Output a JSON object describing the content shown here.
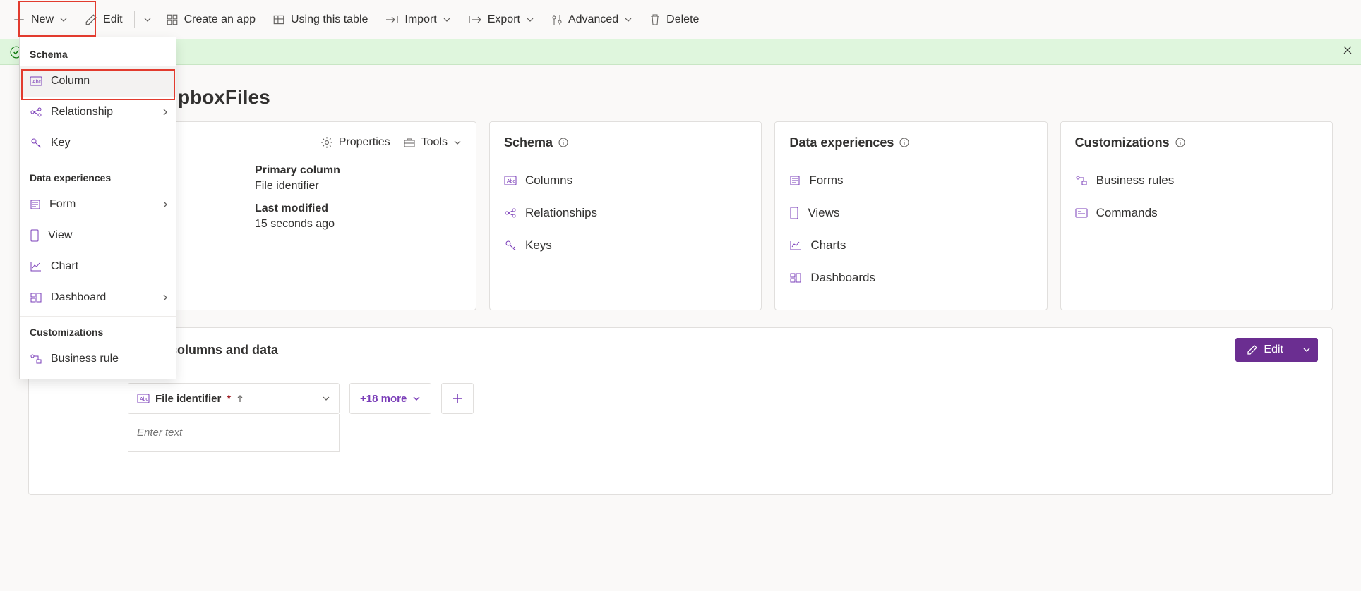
{
  "toolbar": {
    "new": "New",
    "edit": "Edit",
    "create_app": "Create an app",
    "using_table": "Using this table",
    "import": "Import",
    "export": "Export",
    "advanced": "Advanced",
    "delete": "Delete"
  },
  "dropdown": {
    "sections": {
      "schema": "Schema",
      "data_exp": "Data experiences",
      "custom": "Customizations"
    },
    "items": {
      "column": "Column",
      "relationship": "Relationship",
      "key": "Key",
      "form": "Form",
      "view": "View",
      "chart": "Chart",
      "dashboard": "Dashboard",
      "business_rule": "Business rule"
    }
  },
  "page": {
    "title_suffix": "pboxFiles"
  },
  "card1": {
    "properties": "Properties",
    "tools": "Tools",
    "primary_col_label": "Primary column",
    "primary_col_value": "File identifier",
    "last_mod_label": "Last modified",
    "last_mod_value": "15 seconds ago"
  },
  "card2": {
    "title": "Schema",
    "columns": "Columns",
    "relationships": "Relationships",
    "keys": "Keys"
  },
  "card3": {
    "title": "Data experiences",
    "forms": "Forms",
    "views": "Views",
    "charts": "Charts",
    "dashboards": "Dashboards"
  },
  "card4": {
    "title": "Customizations",
    "business_rules": "Business rules",
    "commands": "Commands"
  },
  "data_section": {
    "title_suffix": " columns and data",
    "edit": "Edit",
    "col_name": "File identifier",
    "more": "+18 more",
    "placeholder": "Enter text"
  }
}
